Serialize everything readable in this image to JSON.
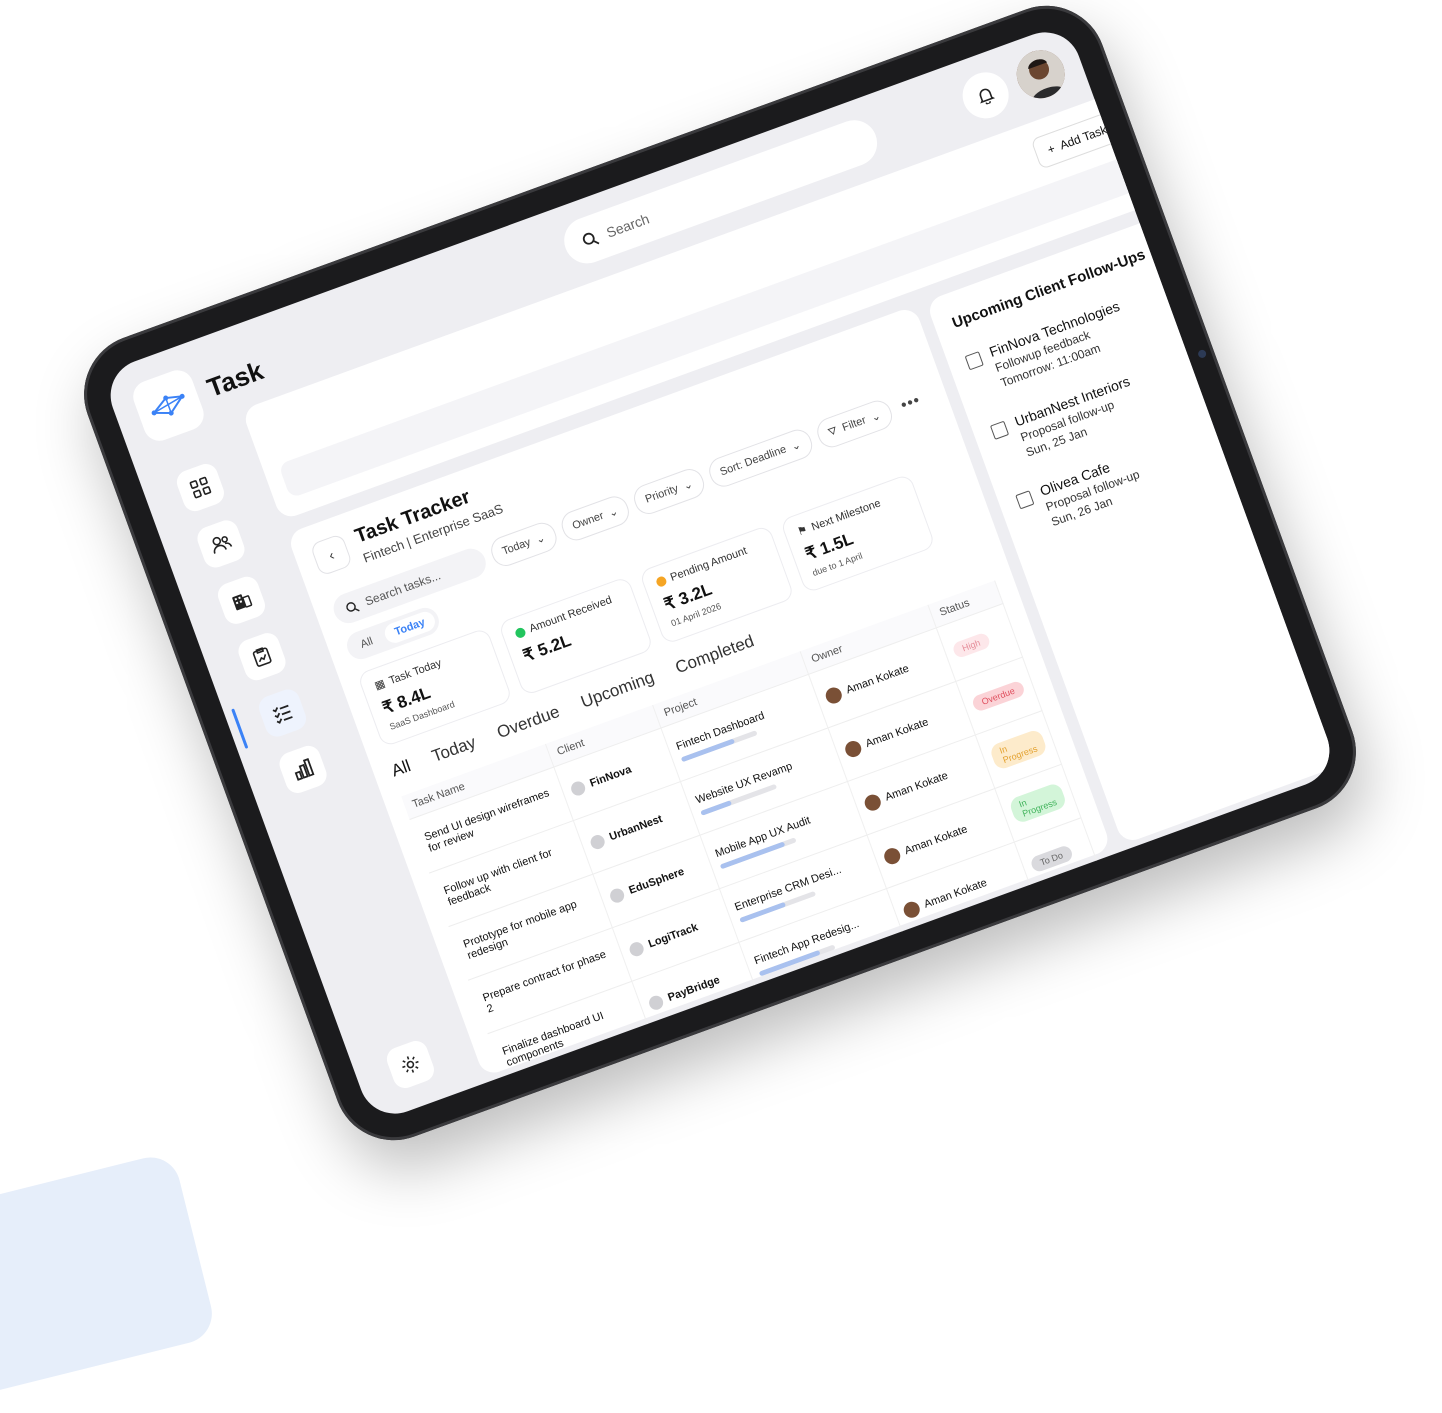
{
  "app": {
    "title": "Task"
  },
  "topbar": {
    "search_placeholder": "Search",
    "add_task_label": "Add Task"
  },
  "tracker": {
    "title": "Task Tracker",
    "subtitle": "Fintech | Enterprise SaaS"
  },
  "filters": {
    "search_placeholder": "Search tasks...",
    "date": "Today",
    "owner": "Owner",
    "priority": "Priority",
    "sort": "Sort: Deadline",
    "filter": "Filter",
    "more": "•••",
    "segments": [
      "All",
      "Today"
    ]
  },
  "stats": [
    {
      "label": "Task Today",
      "value": "₹ 8.4L",
      "note": "SaaS Dashboard",
      "icon": "calendar-icon",
      "color": "#9aa0a6"
    },
    {
      "label": "Amount Received",
      "value": "₹ 5.2L",
      "note": "",
      "icon": "check-circle-icon",
      "color": "#22c55e"
    },
    {
      "label": "Pending Amount",
      "value": "₹ 3.2L",
      "note": "01 April 2026",
      "icon": "pending-dot-icon",
      "color": "#f5a524"
    },
    {
      "label": "Next Milestone",
      "value": "₹ 1.5L",
      "note": "due to 1 April",
      "icon": "flag-icon",
      "color": "#333333"
    }
  ],
  "tabs": [
    "All",
    "Today",
    "Overdue",
    "Upcoming",
    "Completed"
  ],
  "table": {
    "headers": [
      "Task Name",
      "Client",
      "Project",
      "Owner",
      "Status"
    ],
    "rows": [
      {
        "task": "Send UI design wireframes for review",
        "client": "FinNova",
        "project": "Fintech Dashboard",
        "progress": 0.7,
        "owner": "Aman Kokate",
        "status": "High",
        "status_bg": "#fde7ea",
        "status_fg": "#e58a97"
      },
      {
        "task": "Follow up with client for feedback",
        "client": "UrbanNest",
        "project": "Website UX Revamp",
        "progress": 0.4,
        "owner": "Aman Kokate",
        "status": "Overdue",
        "status_bg": "#fbd3d7",
        "status_fg": "#e0505f"
      },
      {
        "task": "Prototype for mobile app redesign",
        "client": "EduSphere",
        "project": "Mobile App UX Audit",
        "progress": 0.85,
        "owner": "Aman Kokate",
        "status": "In Progress",
        "status_bg": "#fdebcb",
        "status_fg": "#e3a12f"
      },
      {
        "task": "Prepare contract for phase 2",
        "client": "LogiTrack",
        "project": "Enterprise CRM Desi...",
        "progress": 0.6,
        "owner": "Aman Kokate",
        "status": "In Progress",
        "status_bg": "#d3f5d9",
        "status_fg": "#3fb35a"
      },
      {
        "task": "Finalize dashboard UI components",
        "client": "PayBridge",
        "project": "Fintech App Redesig...",
        "progress": 0.8,
        "owner": "Aman Kokate",
        "status": "To Do",
        "status_bg": "#dadade",
        "status_fg": "#666666"
      }
    ]
  },
  "followups": {
    "title": "Upcoming Client Follow-Ups",
    "items": [
      {
        "name": "FinNova Technologies",
        "desc": "Followup feedback",
        "time": "Tomorrow: 11:00am"
      },
      {
        "name": "UrbanNest Interiors",
        "desc": "Proposal follow-up",
        "time": "Sun, 25 Jan"
      },
      {
        "name": "Olivea Cafe",
        "desc": "Proposal follow-up",
        "time": "Sun, 26 Jan"
      }
    ]
  },
  "sidebar": {
    "items": [
      {
        "icon": "dashboard-icon",
        "active": false
      },
      {
        "icon": "users-icon",
        "active": false
      },
      {
        "icon": "building-icon",
        "active": false
      },
      {
        "icon": "clipboard-chart-icon",
        "active": false
      },
      {
        "icon": "task-list-icon",
        "active": true
      },
      {
        "icon": "bar-chart-icon",
        "active": false
      }
    ],
    "settings_icon": "gear-icon"
  },
  "colors": {
    "accent": "#3b82f6",
    "bezel": "#1b1b1d",
    "screen": "#eeeef2"
  }
}
